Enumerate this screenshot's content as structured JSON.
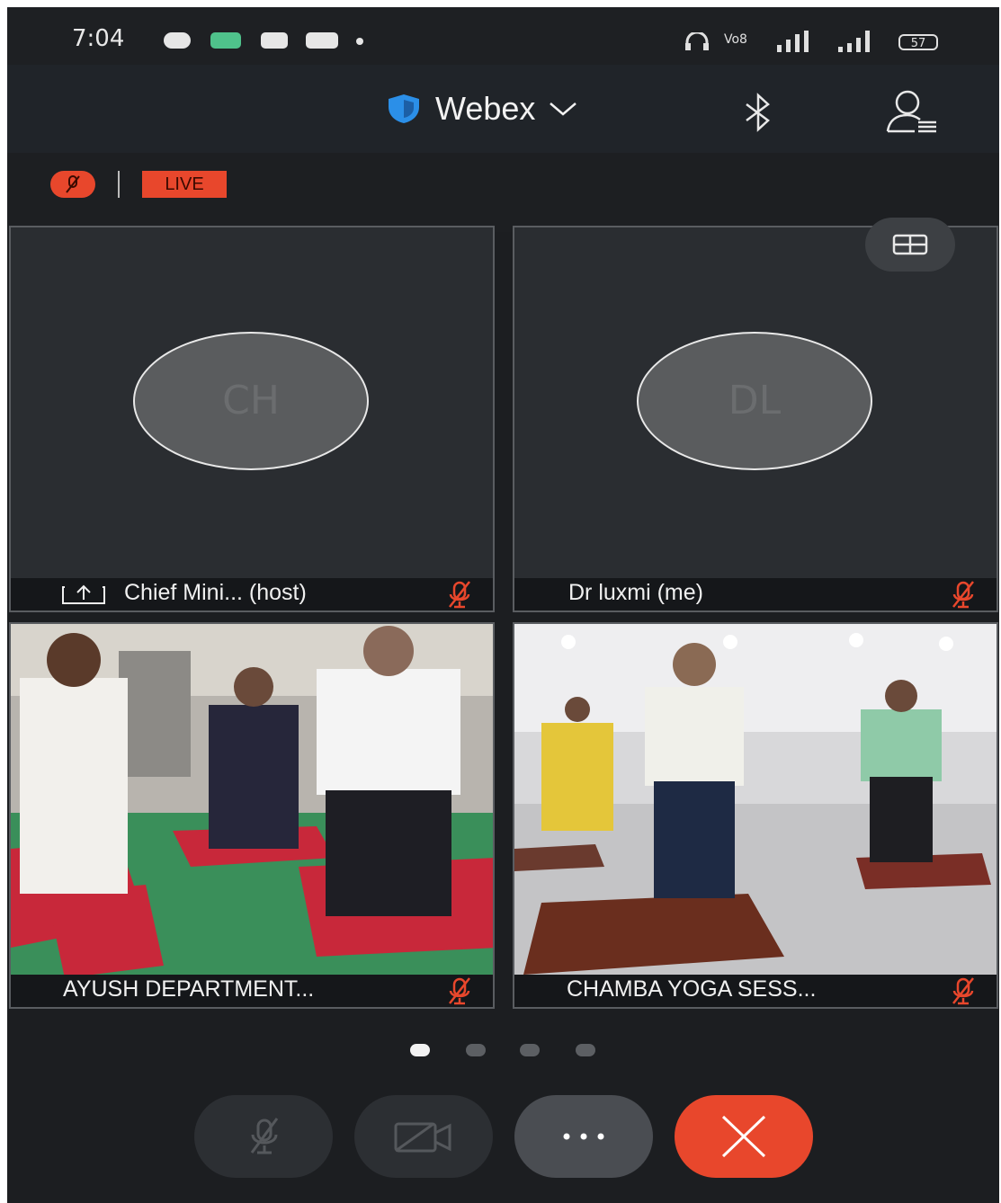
{
  "status_bar": {
    "time": "7:04",
    "network_label": "Vo8",
    "battery": "57"
  },
  "header": {
    "app_name": "Webex",
    "icons": [
      "shield-icon",
      "chevron-down-icon",
      "bluetooth-icon",
      "participants-icon"
    ]
  },
  "live_bar": {
    "live_label": "LIVE"
  },
  "tiles": [
    {
      "initials": "CH",
      "name": "Chief Mini... (host)",
      "sharing": true,
      "muted": true
    },
    {
      "initials": "DL",
      "name": "Dr luxmi (me)",
      "sharing": false,
      "muted": true
    },
    {
      "name": "AYUSH DEPARTMENT...",
      "video": true,
      "muted": true
    },
    {
      "name": "CHAMBA YOGA SESS...",
      "video": true,
      "muted": true
    }
  ],
  "pager": {
    "pages": 4,
    "current": 1
  },
  "controls": [
    "mute-mic-button",
    "stop-video-button",
    "more-options-button",
    "leave-meeting-button"
  ],
  "colors": {
    "accent_red": "#e8472c",
    "background": "#1c1e21",
    "header": "#202429",
    "shield_blue": "#2b8fe8"
  }
}
